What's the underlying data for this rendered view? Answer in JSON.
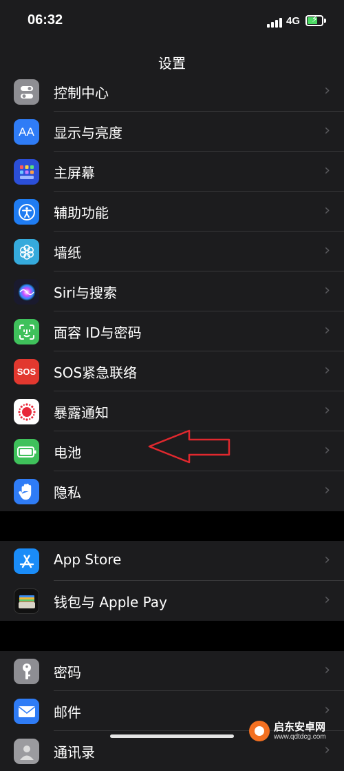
{
  "status": {
    "time": "06:32",
    "network": "4G"
  },
  "nav": {
    "title": "设置"
  },
  "colors": {
    "background": "#000000",
    "cell": "#1c1c1e",
    "separator": "#38383a",
    "annotation_arrow": "#e0282e"
  },
  "groups": [
    {
      "items": [
        {
          "label": "控制中心",
          "icon": "control-center-icon",
          "color": "#8e8e93"
        },
        {
          "label": "显示与亮度",
          "icon": "display-brightness-icon",
          "color": "#2f7cf6"
        },
        {
          "label": "主屏幕",
          "icon": "home-screen-icon",
          "color": "#2b4fd8"
        },
        {
          "label": "辅助功能",
          "icon": "accessibility-icon",
          "color": "#1f7cf2"
        },
        {
          "label": "墙纸",
          "icon": "wallpaper-icon",
          "color": "#35aadc"
        },
        {
          "label": "Siri与搜索",
          "icon": "siri-icon",
          "color": "#1a1a2e"
        },
        {
          "label": "面容 ID与密码",
          "icon": "face-id-icon",
          "color": "#3fc15b"
        },
        {
          "label": "SOS紧急联络",
          "icon": "sos-icon",
          "color": "#e2382f",
          "icon_text": "SOS"
        },
        {
          "label": "暴露通知",
          "icon": "exposure-notification-icon",
          "color": "#ffffff"
        },
        {
          "label": "电池",
          "icon": "battery-icon",
          "color": "#3fc15b"
        },
        {
          "label": "隐私",
          "icon": "privacy-hand-icon",
          "color": "#2f7cf6"
        }
      ]
    },
    {
      "items": [
        {
          "label": "App Store",
          "icon": "app-store-icon",
          "color": "#1a8cf8"
        },
        {
          "label": "钱包与 Apple Pay",
          "icon": "wallet-icon",
          "color": "#111111"
        }
      ]
    },
    {
      "items": [
        {
          "label": "密码",
          "icon": "key-icon",
          "color": "#8e8e93"
        },
        {
          "label": "邮件",
          "icon": "mail-icon",
          "color": "#2f7cf6"
        },
        {
          "label": "通讯录",
          "icon": "contacts-icon",
          "color": "#9b9b9f"
        }
      ]
    }
  ],
  "watermark": {
    "name": "启东安卓网",
    "url": "www.qdtdcg.com"
  }
}
